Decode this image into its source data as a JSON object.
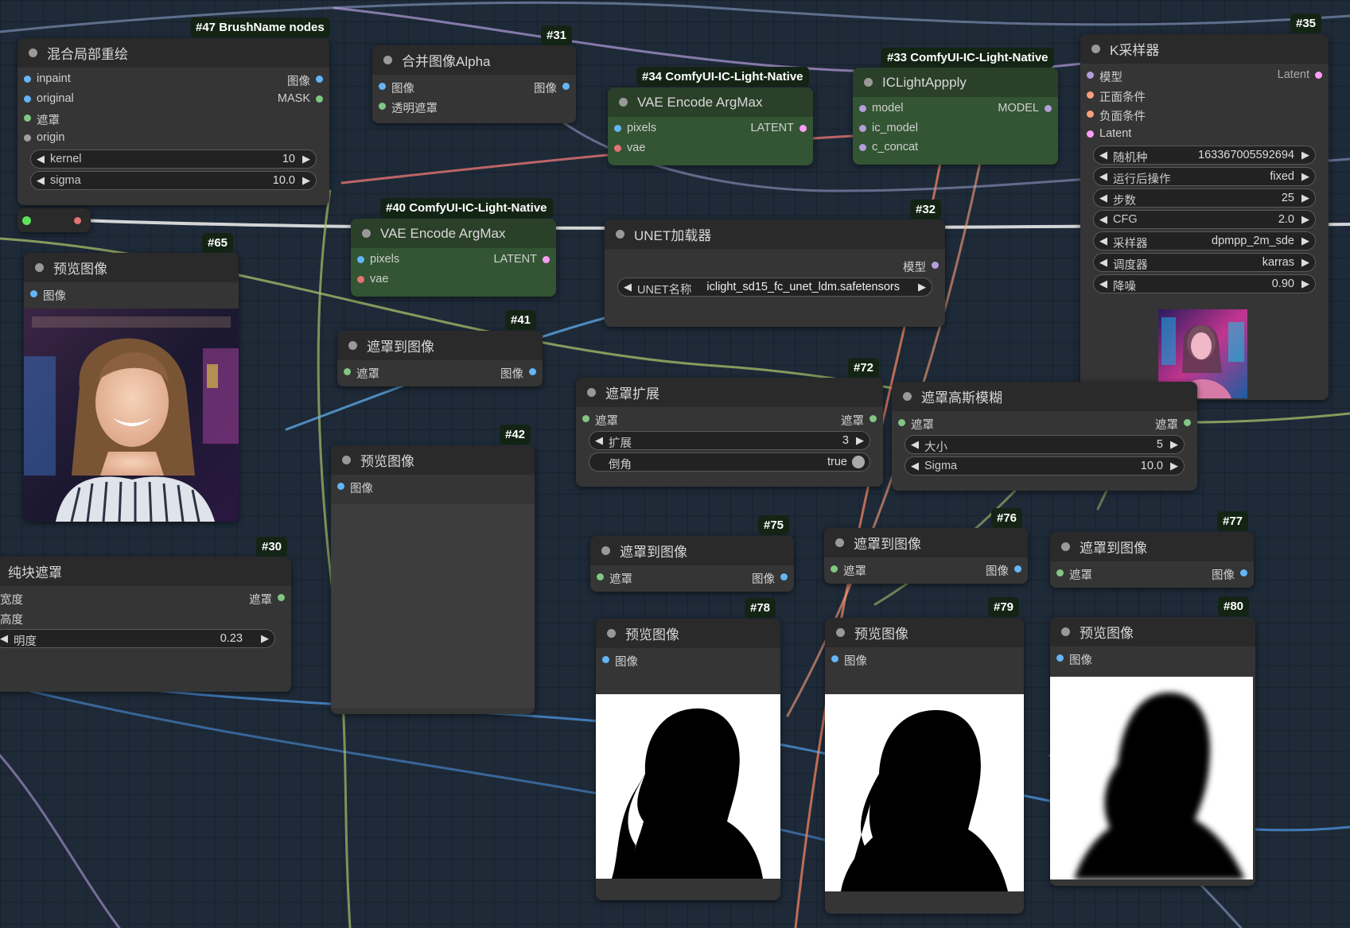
{
  "colors": {
    "canvas": "#1e2a38",
    "node": "#353535",
    "node_green": "#335533",
    "badge": "#132414",
    "image_slot": "#ff9cf9",
    "mask_slot": "#81c784",
    "latent_slot": "#ff9cf9"
  },
  "nodes": {
    "n47": {
      "id": "#47 BrushName nodes",
      "title": "混合局部重绘",
      "in1": "inpaint",
      "in2": "original",
      "in3": "遮罩",
      "in4": "origin",
      "out1": "图像",
      "out2": "MASK",
      "w1l": "kernel",
      "w1v": "10",
      "w2l": "sigma",
      "w2v": "10.0"
    },
    "n31": {
      "id": "#31",
      "title": "合并图像Alpha",
      "in1": "图像",
      "in2": "透明遮罩",
      "out1": "图像"
    },
    "n34": {
      "id": "#34 ComfyUI-IC-Light-Native",
      "title": "VAE Encode ArgMax",
      "in1": "pixels",
      "in2": "vae",
      "out1": "LATENT"
    },
    "n33": {
      "id": "#33 ComfyUI-IC-Light-Native",
      "title": "ICLightAppply",
      "in1": "model",
      "in2": "ic_model",
      "in3": "c_concat",
      "out1": "MODEL"
    },
    "n35": {
      "id": "#35",
      "title": "K采样器",
      "in1": "模型",
      "in2": "正面条件",
      "in3": "负面条件",
      "in4": "Latent",
      "out1": "Latent",
      "w": [
        {
          "l": "随机种",
          "v": "163367005592694"
        },
        {
          "l": "运行后操作",
          "v": "fixed"
        },
        {
          "l": "步数",
          "v": "25"
        },
        {
          "l": "CFG",
          "v": "2.0"
        },
        {
          "l": "采样器",
          "v": "dpmpp_2m_sde"
        },
        {
          "l": "调度器",
          "v": "karras"
        },
        {
          "l": "降噪",
          "v": "0.90"
        }
      ]
    },
    "n65": {
      "id": "#65",
      "title": "预览图像",
      "in1": "图像"
    },
    "n40": {
      "id": "#40 ComfyUI-IC-Light-Native",
      "title": "VAE Encode ArgMax",
      "in1": "pixels",
      "in2": "vae",
      "out1": "LATENT"
    },
    "n32": {
      "id": "#32",
      "title": "UNET加载器",
      "out1": "模型",
      "w1l": "UNET名称",
      "w1v": "iclight_sd15_fc_unet_ldm.safetensors"
    },
    "n41": {
      "id": "#41",
      "title": "遮罩到图像",
      "in1": "遮罩",
      "out1": "图像"
    },
    "n42": {
      "id": "#42",
      "title": "预览图像",
      "in1": "图像"
    },
    "n72": {
      "id": "#72",
      "title": "遮罩扩展",
      "in1": "遮罩",
      "out1": "遮罩",
      "w1l": "扩展",
      "w1v": "3",
      "w2l": "倒角",
      "w2v": "true"
    },
    "n_gauss": {
      "title": "遮罩高斯模糊",
      "in1": "遮罩",
      "out1": "遮罩",
      "w1l": "大小",
      "w1v": "5",
      "w2l": "Sigma",
      "w2v": "10.0"
    },
    "n30": {
      "id": "#30",
      "title": "纯块遮罩",
      "in1": "宽度",
      "in2": "高度",
      "out1": "遮罩",
      "w1l": "明度",
      "w1v": "0.23"
    },
    "n75": {
      "id": "#75",
      "title": "遮罩到图像",
      "in1": "遮罩",
      "out1": "图像"
    },
    "n76": {
      "id": "#76",
      "title": "遮罩到图像",
      "in1": "遮罩",
      "out1": "图像"
    },
    "n77": {
      "id": "#77",
      "title": "遮罩到图像",
      "in1": "遮罩",
      "out1": "图像"
    },
    "n78": {
      "id": "#78",
      "title": "预览图像",
      "in1": "图像"
    },
    "n79": {
      "id": "#79",
      "title": "预览图像",
      "in1": "图像"
    },
    "n80": {
      "id": "#80",
      "title": "预览图像",
      "in1": "图像"
    }
  }
}
